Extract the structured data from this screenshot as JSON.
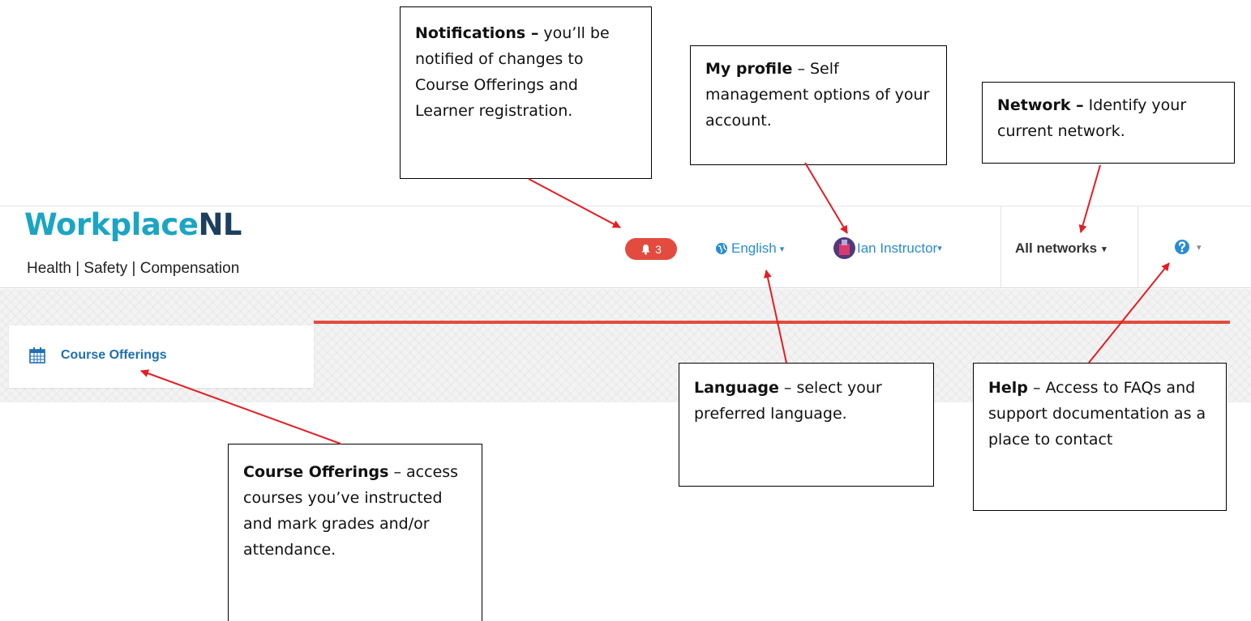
{
  "header": {
    "logo_main": "Workplace",
    "logo_suffix": "NL",
    "logo_tagline": "Health | Safety | Compensation",
    "notifications_count": "3",
    "language_label": "English",
    "profile_name": "Ian Instructor",
    "network_label": "All networks"
  },
  "nav": {
    "items": [
      {
        "label": "Course Offerings",
        "icon": "calendar-icon"
      }
    ]
  },
  "callouts": {
    "notifications": {
      "title": "Notifications –",
      "body": " you’ll be notified of changes to Course Offerings and Learner registration."
    },
    "profile": {
      "title": "My profile",
      "body": " – Self management options of your account."
    },
    "network": {
      "title": "Network –",
      "body": " Identify your current network."
    },
    "language": {
      "title": "Language",
      "body": " – select your preferred language."
    },
    "help": {
      "title": "Help",
      "body": " – Access to FAQs and support documentation as a place to contact"
    },
    "courses": {
      "title": "Course Offerings",
      "body": " – access courses you’ve instructed and mark grades and/or attendance."
    }
  },
  "colors": {
    "accent_red": "#e34b3f",
    "link_blue": "#2a8cd2",
    "logo_teal": "#1ba5c3",
    "logo_navy": "#1c3f5e"
  }
}
